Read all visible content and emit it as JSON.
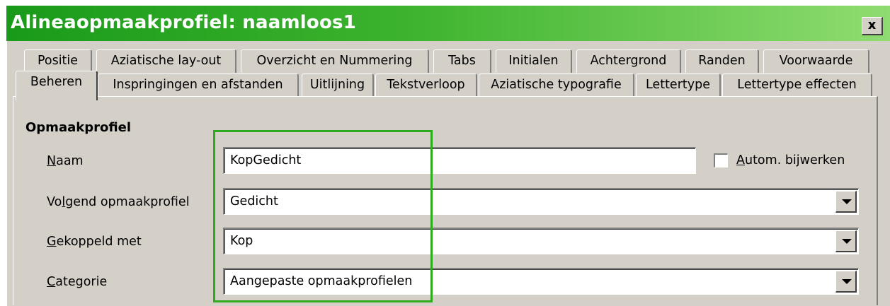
{
  "window": {
    "title": "Alineaopmaakprofiel: naamloos1",
    "close_label": "x"
  },
  "tabs_row1": [
    {
      "label": "Positie"
    },
    {
      "label": "Aziatische lay-out"
    },
    {
      "label": "Overzicht en Nummering"
    },
    {
      "label": "Tabs"
    },
    {
      "label": "Initialen"
    },
    {
      "label": "Achtergrond"
    },
    {
      "label": "Randen"
    },
    {
      "label": "Voorwaarde"
    }
  ],
  "tabs_row2": [
    {
      "label": "Beheren",
      "active": true
    },
    {
      "label": "Inspringingen en afstanden"
    },
    {
      "label": "Uitlijning"
    },
    {
      "label": "Tekstverloop"
    },
    {
      "label": "Aziatische typografie"
    },
    {
      "label": "Lettertype"
    },
    {
      "label": "Lettertype effecten"
    }
  ],
  "group": {
    "title": "Opmaakprofiel"
  },
  "fields": {
    "naam": {
      "label_accel": "N",
      "label_rest": "aam",
      "value": "KopGedicht"
    },
    "volgend": {
      "label_pre": "Vo",
      "label_accel": "l",
      "label_rest": "gend opmaakprofiel",
      "value": "Gedicht"
    },
    "gekoppeld": {
      "label_accel": "G",
      "label_rest": "ekoppeld met",
      "value": "Kop"
    },
    "categorie": {
      "label_accel": "C",
      "label_rest": "ategorie",
      "value": "Aangepaste opmaakprofielen"
    }
  },
  "autoupdate": {
    "label_accel": "A",
    "label_rest": "utom. bijwerken",
    "checked": false
  },
  "colors": {
    "title_gradient_start": "#1a9a1a",
    "title_gradient_end": "#8fdc70",
    "highlight_border": "#2eaa1e",
    "dialog_bg": "#d4d0c8"
  }
}
